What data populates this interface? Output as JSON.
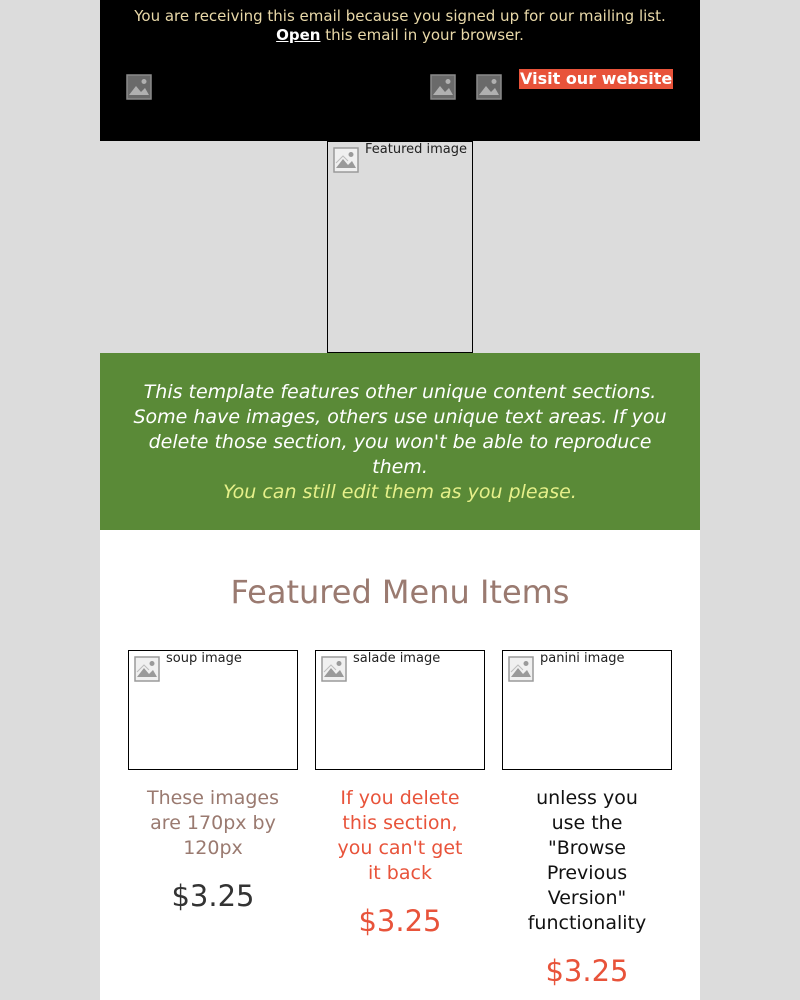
{
  "header": {
    "preheader_before": "You are receiving this email because you signed up for our mailing list.",
    "open_link": "Open",
    "preheader_after": "this email in your browser.",
    "visit_button": "Visit our website",
    "social_icons": [
      "image-icon",
      "image-icon",
      "image-icon"
    ]
  },
  "featured_image": {
    "alt": "Featured image"
  },
  "banner": {
    "text": "This template features other unique content sections. Some have images, others use unique text areas. If you delete those section, you won't be able to reproduce them.",
    "highlight": "You can still edit them as you please."
  },
  "menu": {
    "title": "Featured Menu Items",
    "items": [
      {
        "image_alt": "soup image",
        "text": "These images are 170px by 120px",
        "price": "$3.25",
        "text_color": "#9a7a70",
        "price_color": "#333333"
      },
      {
        "image_alt": "salade image",
        "text": "If you delete this section, you can't get it back",
        "price": "$3.25",
        "text_color": "#e8533a",
        "price_color": "#e8533a"
      },
      {
        "image_alt": "panini image",
        "text": "unless you use the \"Browse Previous Version\" functionality",
        "price": "$3.25",
        "text_color": "#111111",
        "price_color": "#e8533a"
      }
    ]
  },
  "colors": {
    "header_bg": "#000000",
    "page_bg": "#dcdcdc",
    "banner_bg": "#5a8a37",
    "banner_highlight": "#e6f08a",
    "accent": "#e8533a",
    "title": "#9a7a70"
  }
}
